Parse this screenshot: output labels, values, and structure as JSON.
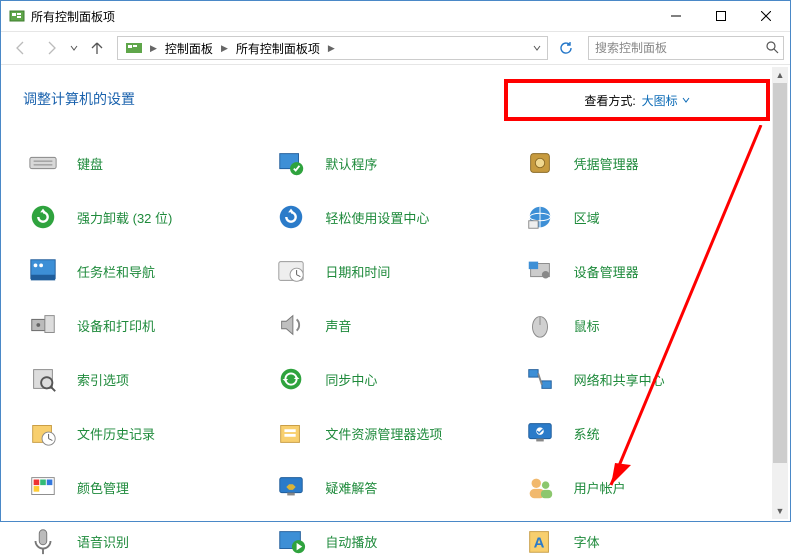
{
  "window": {
    "title": "所有控制面板项"
  },
  "nav": {
    "crumb1": "控制面板",
    "crumb2": "所有控制面板项",
    "search_placeholder": "搜索控制面板"
  },
  "main": {
    "heading": "调整计算机的设置",
    "view_label": "查看方式:",
    "view_value": "大图标"
  },
  "items": [
    {
      "label": "键盘",
      "icon": "keyboard"
    },
    {
      "label": "默认程序",
      "icon": "defaults"
    },
    {
      "label": "凭据管理器",
      "icon": "vault"
    },
    {
      "label": "强力卸载 (32 位)",
      "icon": "recycle360"
    },
    {
      "label": "轻松使用设置中心",
      "icon": "ease"
    },
    {
      "label": "区域",
      "icon": "region"
    },
    {
      "label": "任务栏和导航",
      "icon": "taskbar"
    },
    {
      "label": "日期和时间",
      "icon": "datetime"
    },
    {
      "label": "设备管理器",
      "icon": "devmgr"
    },
    {
      "label": "设备和打印机",
      "icon": "devices"
    },
    {
      "label": "声音",
      "icon": "sound"
    },
    {
      "label": "鼠标",
      "icon": "mouse"
    },
    {
      "label": "索引选项",
      "icon": "indexing"
    },
    {
      "label": "同步中心",
      "icon": "sync"
    },
    {
      "label": "网络和共享中心",
      "icon": "network"
    },
    {
      "label": "文件历史记录",
      "icon": "filehist"
    },
    {
      "label": "文件资源管理器选项",
      "icon": "folderopt"
    },
    {
      "label": "系统",
      "icon": "system"
    },
    {
      "label": "颜色管理",
      "icon": "color"
    },
    {
      "label": "疑难解答",
      "icon": "trouble"
    },
    {
      "label": "用户帐户",
      "icon": "users"
    },
    {
      "label": "语音识别",
      "icon": "speech"
    },
    {
      "label": "自动播放",
      "icon": "autoplay"
    },
    {
      "label": "字体",
      "icon": "fonts"
    }
  ]
}
